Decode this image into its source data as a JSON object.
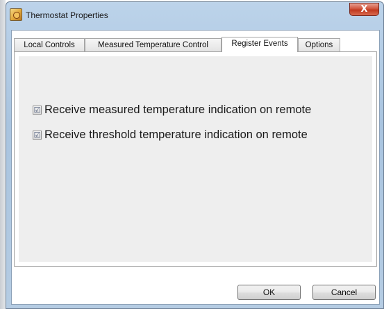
{
  "window": {
    "title": "Thermostat Properties",
    "icon": "thermostat-app-icon",
    "close_glyph": "X"
  },
  "tabs": [
    {
      "label": "Local Controls",
      "active": false
    },
    {
      "label": "Measured Temperature Control",
      "active": false
    },
    {
      "label": "Register Events",
      "active": true
    },
    {
      "label": "Options",
      "active": false
    }
  ],
  "register_events": {
    "options": [
      {
        "label": "Receive measured temperature indication on remote",
        "checked": true,
        "mark": "☑"
      },
      {
        "label": "Receive threshold temperature indication on remote",
        "checked": true,
        "mark": "☑"
      }
    ]
  },
  "buttons": {
    "ok": "OK",
    "cancel": "Cancel"
  }
}
